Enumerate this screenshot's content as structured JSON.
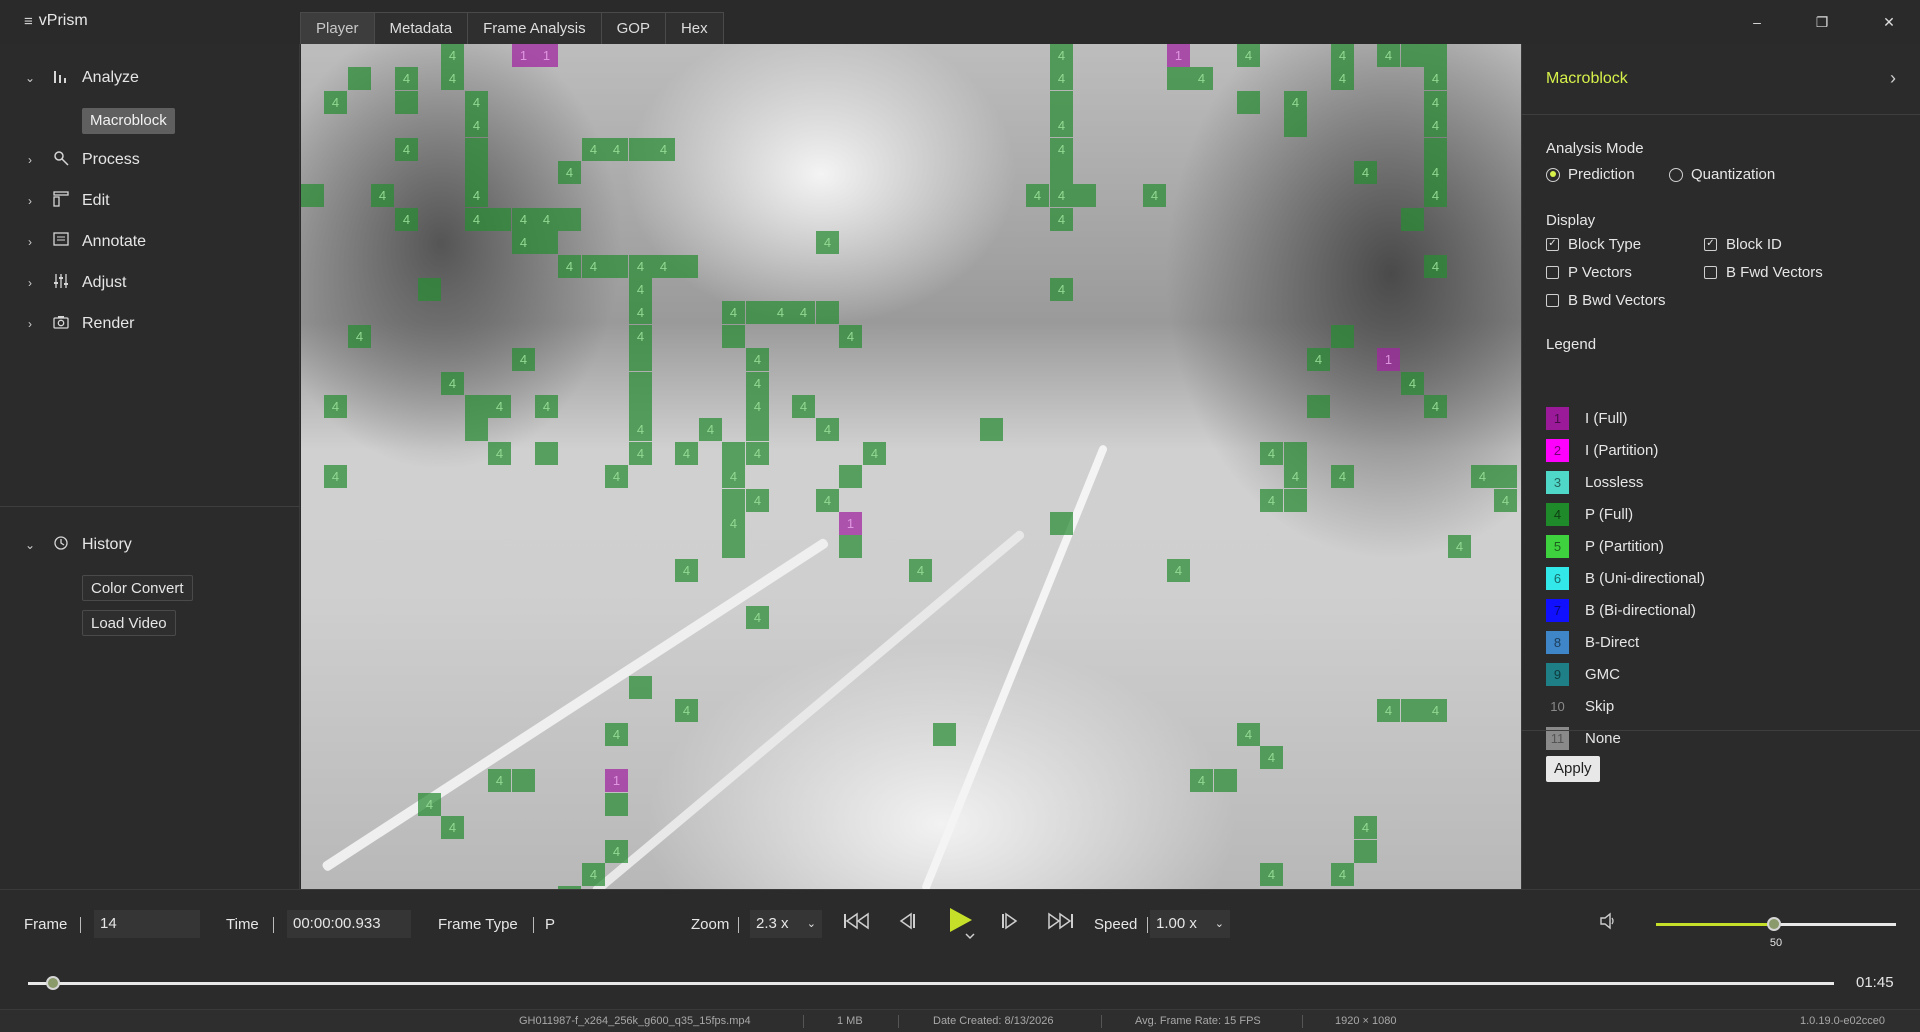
{
  "app": {
    "title": "vPrism"
  },
  "tabs": [
    {
      "label": "Player",
      "active": true
    },
    {
      "label": "Metadata"
    },
    {
      "label": "Frame Analysis"
    },
    {
      "label": "GOP"
    },
    {
      "label": "Hex"
    }
  ],
  "window_controls": {
    "minimize": "–",
    "restore": "❐",
    "close": "✕"
  },
  "sidebar": {
    "analyze": "Analyze",
    "macroblock": "Macroblock",
    "process": "Process",
    "edit": "Edit",
    "annotate": "Annotate",
    "adjust": "Adjust",
    "render": "Render",
    "history": "History",
    "history_items": [
      "Color Convert",
      "Load Video"
    ]
  },
  "panel": {
    "title": "Macroblock",
    "analysis_mode_label": "Analysis Mode",
    "mode_prediction": "Prediction",
    "mode_quantization": "Quantization",
    "display_label": "Display",
    "display_options": [
      {
        "label": "Block Type",
        "checked": true
      },
      {
        "label": "Block ID",
        "checked": true
      },
      {
        "label": "P Vectors",
        "checked": false
      },
      {
        "label": "B Fwd Vectors",
        "checked": false
      },
      {
        "label": "B Bwd Vectors",
        "checked": false
      }
    ],
    "legend_label": "Legend",
    "legend": [
      {
        "id": "1",
        "label": "I (Full)",
        "color": "#9a1a9a"
      },
      {
        "id": "2",
        "label": "I (Partition)",
        "color": "#ff00ff"
      },
      {
        "id": "3",
        "label": "Lossless",
        "color": "#4fd8c8"
      },
      {
        "id": "4",
        "label": "P (Full)",
        "color": "#1f8a2a"
      },
      {
        "id": "5",
        "label": "P (Partition)",
        "color": "#3fd23f"
      },
      {
        "id": "6",
        "label": "B (Uni-directional)",
        "color": "#33e8e8"
      },
      {
        "id": "7",
        "label": "B (Bi-directional)",
        "color": "#1010ff"
      },
      {
        "id": "8",
        "label": "B-Direct",
        "color": "#3f86c8"
      },
      {
        "id": "9",
        "label": "GMC",
        "color": "#1f7f86"
      },
      {
        "id": "10",
        "label": "Skip",
        "color": "#2b2b2b"
      },
      {
        "id": "11",
        "label": "None",
        "color": "#8a8a8a"
      }
    ],
    "apply": "Apply"
  },
  "controls": {
    "frame_label": "Frame",
    "frame_value": "14",
    "time_label": "Time",
    "time_value": "00:00:00.933",
    "frame_type_label": "Frame Type",
    "frame_type_value": "P",
    "zoom_label": "Zoom",
    "zoom_value": "2.3 x",
    "speed_label": "Speed",
    "speed_value": "1.00 x",
    "volume_value": "50",
    "volume_level": 0.5,
    "playback_progress": 0.01,
    "duration": "01:45"
  },
  "status": {
    "file": "GH011987-f_x264_256k_g600_q35_15fps.mp4",
    "size": "1 MB",
    "date": "Date Created: 8/13/2026",
    "fps": "Avg. Frame Rate: 15 FPS",
    "resolution": "1920 × 1080",
    "version": "1.0.19.0-e02cce0"
  },
  "macroblock_overlay": {
    "label": "4",
    "partition_label": "1",
    "color": "#288c32",
    "partition_color": "#a028a0"
  }
}
